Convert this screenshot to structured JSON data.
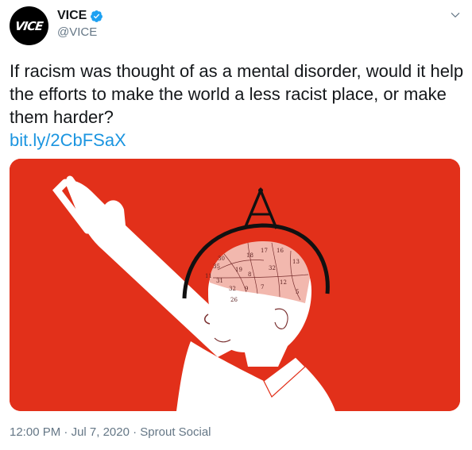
{
  "author": {
    "display_name": "VICE",
    "handle": "@VICE",
    "avatar_text": "VICE",
    "verified": true
  },
  "tweet": {
    "text": "If racism was thought of as a mental disorder, would it help the efforts to make the world a less racist place, or make them harder?",
    "link": "bit.ly/2CbFSaX"
  },
  "media": {
    "background_color": "#e2301a",
    "phrenology_numbers": [
      "17",
      "16",
      "18",
      "30",
      "35",
      "19",
      "11",
      "13",
      "32",
      "12",
      "7",
      "8",
      "31",
      "9",
      "32",
      "5",
      "26"
    ]
  },
  "meta": {
    "time": "12:00 PM",
    "separator": " · ",
    "date": "Jul 7, 2020",
    "source": "Sprout Social"
  },
  "colors": {
    "link": "#1b95e0",
    "secondary_text": "#657786",
    "verified_badge": "#1da1f2"
  },
  "icons": {
    "verified": "verified-badge-icon",
    "menu": "chevron-down-icon"
  }
}
